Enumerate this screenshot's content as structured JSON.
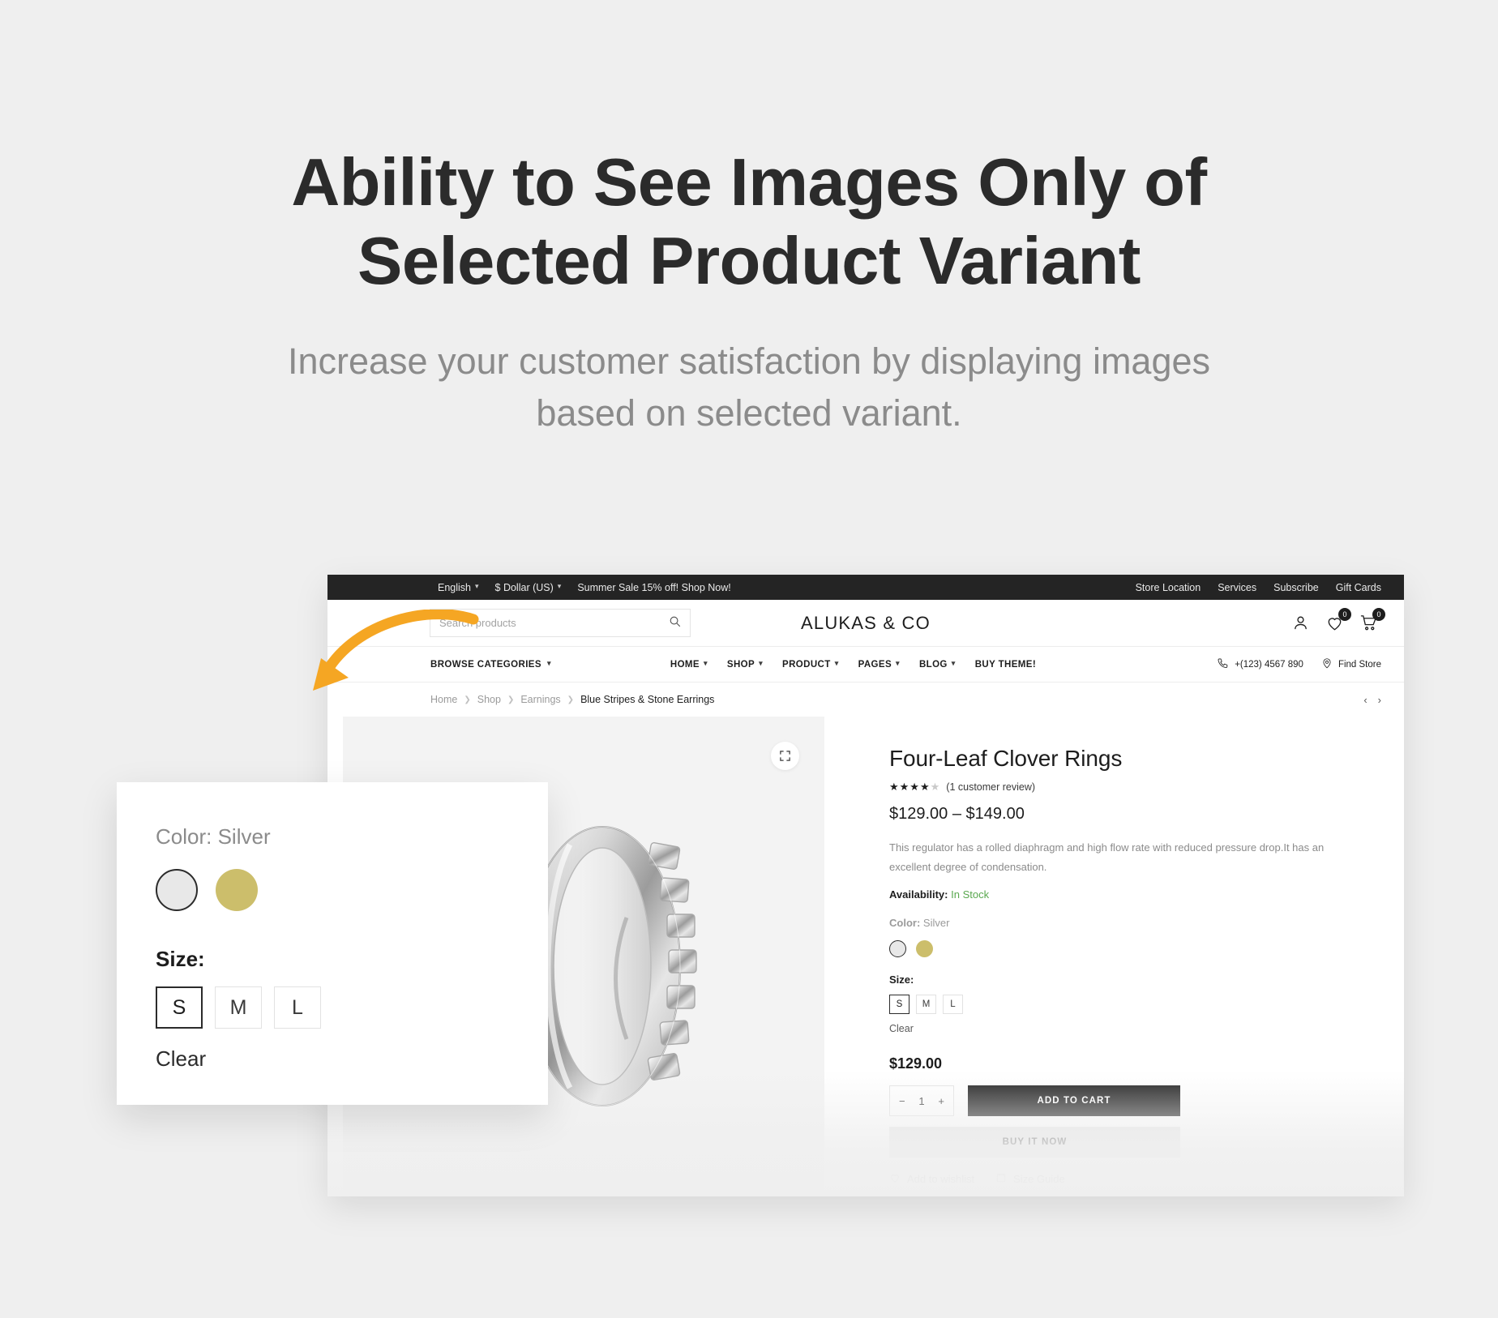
{
  "promo": {
    "title": "Ability to See Images Only of Selected Product Variant",
    "subtitle": "Increase your customer satisfaction by displaying images based on selected variant."
  },
  "topbar": {
    "language": "English",
    "currency": "$ Dollar (US)",
    "announcement": "Summer Sale 15% off! Shop Now!",
    "links": [
      "Store Location",
      "Services",
      "Subscribe",
      "Gift Cards"
    ]
  },
  "header": {
    "search_placeholder": "Search products",
    "search_value": "",
    "logo": "ALUKAS & CO",
    "wishlist_count": "0",
    "cart_count": "0"
  },
  "nav": {
    "browse": "BROWSE CATEGORIES",
    "items": [
      "HOME",
      "SHOP",
      "PRODUCT",
      "PAGES",
      "BLOG",
      "BUY THEME!"
    ],
    "phone": "+(123) 4567 890",
    "find_store": "Find Store"
  },
  "breadcrumb": {
    "items": [
      "Home",
      "Shop",
      "Earnings"
    ],
    "current": "Blue Stripes & Stone Earrings"
  },
  "product": {
    "title": "Four-Leaf Clover Rings",
    "stars_filled": 4,
    "stars_total": 5,
    "review_text": "(1 customer review)",
    "price_range": "$129.00 – $149.00",
    "description": "This regulator has a rolled diaphragm and high flow rate with reduced pressure drop.It has an excellent degree of condensation.",
    "availability_label": "Availability:",
    "availability_value": "In Stock",
    "color_label": "Color:",
    "color_value": "Silver",
    "colors": [
      {
        "name": "silver",
        "hex": "#e8e8e8",
        "selected": true
      },
      {
        "name": "gold",
        "hex": "#ccbe6b",
        "selected": false
      }
    ],
    "size_label": "Size:",
    "sizes": [
      {
        "label": "S",
        "selected": true
      },
      {
        "label": "M",
        "selected": false
      },
      {
        "label": "L",
        "selected": false
      }
    ],
    "clear": "Clear",
    "selected_price": "$129.00",
    "quantity": "1",
    "minus": "−",
    "plus": "+",
    "add_to_cart": "ADD TO CART",
    "buy_it_now": "BUY IT NOW",
    "add_to_wishlist": "Add to wishlist",
    "size_guide": "Size Guide"
  },
  "variant_card": {
    "color_label": "Color:",
    "color_value": "Silver",
    "colors": [
      {
        "name": "silver",
        "hex": "#e8e8e8",
        "selected": true
      },
      {
        "name": "gold",
        "hex": "#ccbe6b",
        "selected": false
      }
    ],
    "size_label": "Size:",
    "sizes": [
      {
        "label": "S",
        "selected": true
      },
      {
        "label": "M",
        "selected": false
      },
      {
        "label": "L",
        "selected": false
      }
    ],
    "clear": "Clear"
  },
  "colors": {
    "background": "#efefef",
    "accent_gold": "#ccbe6b",
    "arrow_orange": "#f5a623",
    "dark": "#1d1d1d",
    "in_stock_green": "#5aa84f"
  }
}
